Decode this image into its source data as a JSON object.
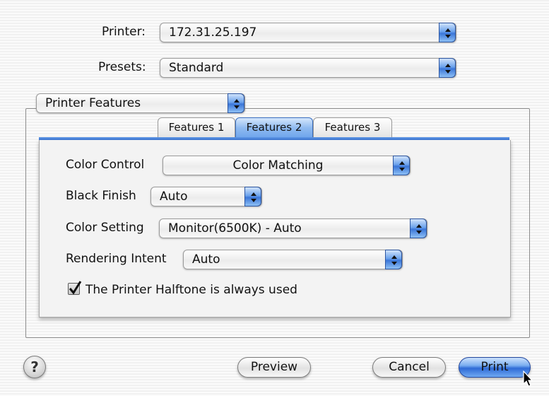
{
  "printer": {
    "label": "Printer:",
    "value": "172.31.25.197"
  },
  "presets": {
    "label": "Presets:",
    "value": "Standard"
  },
  "section_menu": {
    "value": "Printer Features"
  },
  "tabs": [
    {
      "label": "Features 1",
      "active": false
    },
    {
      "label": "Features 2",
      "active": true
    },
    {
      "label": "Features 3",
      "active": false
    }
  ],
  "features": {
    "color_control": {
      "label": "Color Control",
      "value": "Color Matching"
    },
    "black_finish": {
      "label": "Black Finish",
      "value": "Auto"
    },
    "color_setting": {
      "label": "Color Setting",
      "value": "Monitor(6500K) - Auto"
    },
    "rendering_intent": {
      "label": "Rendering Intent",
      "value": "Auto"
    },
    "halftone": {
      "label": "The Printer Halftone is always used",
      "checked": true
    }
  },
  "buttons": {
    "help": "?",
    "preview": "Preview",
    "cancel": "Cancel",
    "print": "Print"
  },
  "colors": {
    "accent": "#3b76d8"
  }
}
